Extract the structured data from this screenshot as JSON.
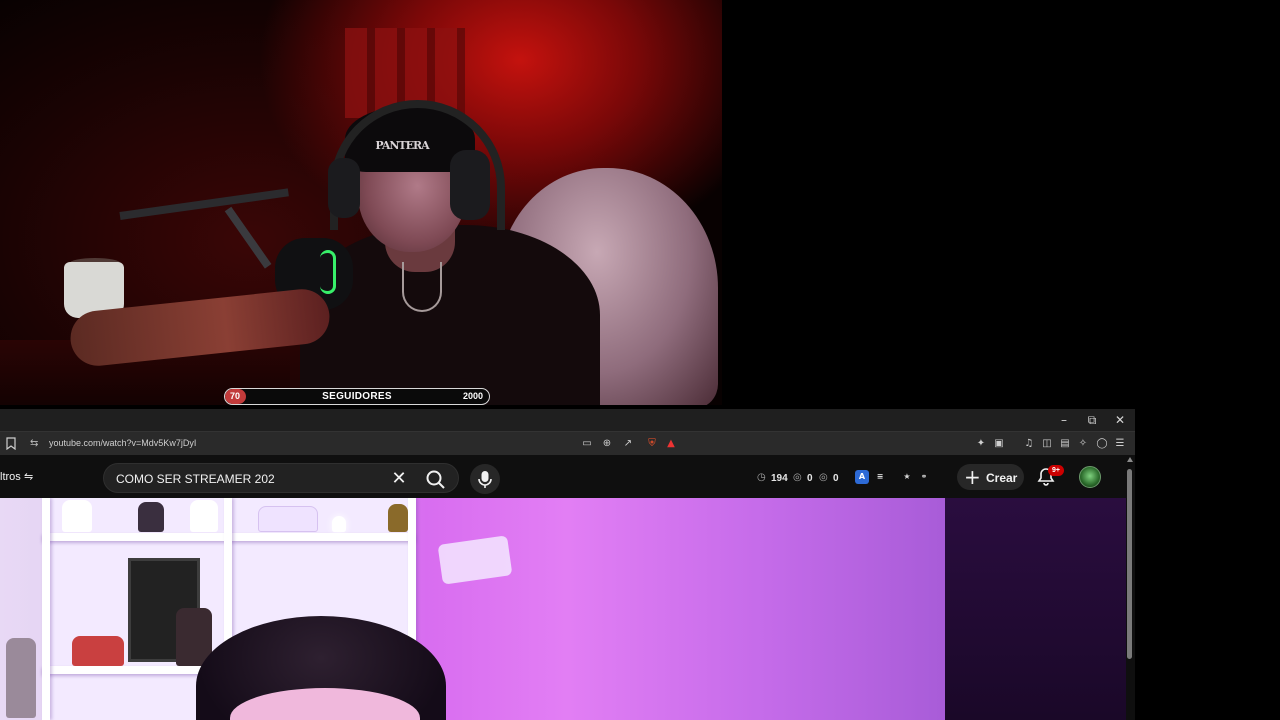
{
  "overlay": {
    "goal": {
      "current": 70,
      "label": "SEGUIDORES",
      "target": 2000,
      "progress": 0.035
    },
    "beanie_text": "PANTERA"
  },
  "browser": {
    "url": "youtube.com/watch?v=Mdv5Kw7jDyI",
    "window_controls": [
      "minimize",
      "restore",
      "close"
    ]
  },
  "youtube": {
    "filters_label": "ltros",
    "search": {
      "value": "COMO SER STREAMER 202"
    },
    "stats": {
      "clock": "194",
      "views": "0",
      "watchers": "0"
    },
    "create_label": "Crear",
    "notifications_badge": "9+"
  },
  "colors": {
    "accent_red": "#cc0000",
    "goal_fill": "#c23b3b",
    "yt_bg": "#0f0f0f"
  }
}
